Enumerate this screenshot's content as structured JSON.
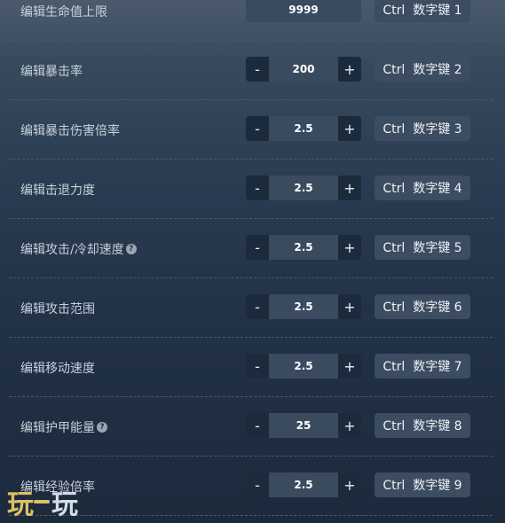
{
  "rows": [
    {
      "label": "编辑生命值上限",
      "type": "input",
      "value": "9999",
      "hotkey": "Ctrl  数字键 1"
    },
    {
      "label": "编辑暴击率",
      "type": "stepper",
      "value": "200",
      "hotkey": "Ctrl  数字键 2"
    },
    {
      "label": "编辑暴击伤害倍率",
      "type": "stepper",
      "value": "2.5",
      "hotkey": "Ctrl  数字键 3"
    },
    {
      "label": "编辑击退力度",
      "type": "stepper",
      "value": "2.5",
      "hotkey": "Ctrl  数字键 4"
    },
    {
      "label": "编辑攻击/冷却速度",
      "type": "stepper",
      "value": "2.5",
      "hotkey": "Ctrl  数字键 5",
      "help": "?"
    },
    {
      "label": "编辑攻击范围",
      "type": "stepper",
      "value": "2.5",
      "hotkey": "Ctrl  数字键 6"
    },
    {
      "label": "编辑移动速度",
      "type": "stepper",
      "value": "2.5",
      "hotkey": "Ctrl  数字键 7"
    },
    {
      "label": "编辑护甲能量",
      "type": "stepper",
      "value": "25",
      "hotkey": "Ctrl  数字键 8",
      "help": "?"
    },
    {
      "label": "编辑经验倍率",
      "type": "stepper",
      "value": "2.5",
      "hotkey": "Ctrl  数字键 9"
    }
  ],
  "stepper": {
    "minus_label": "-",
    "plus_label": "+"
  },
  "watermark": {
    "left": "玩",
    "right": "玩"
  },
  "colors": {
    "background_top": "#4b5b6d",
    "background_bottom": "#1c2a3c",
    "value_box": "#3a4b5f",
    "hotkey_button": "#3c4d61"
  }
}
